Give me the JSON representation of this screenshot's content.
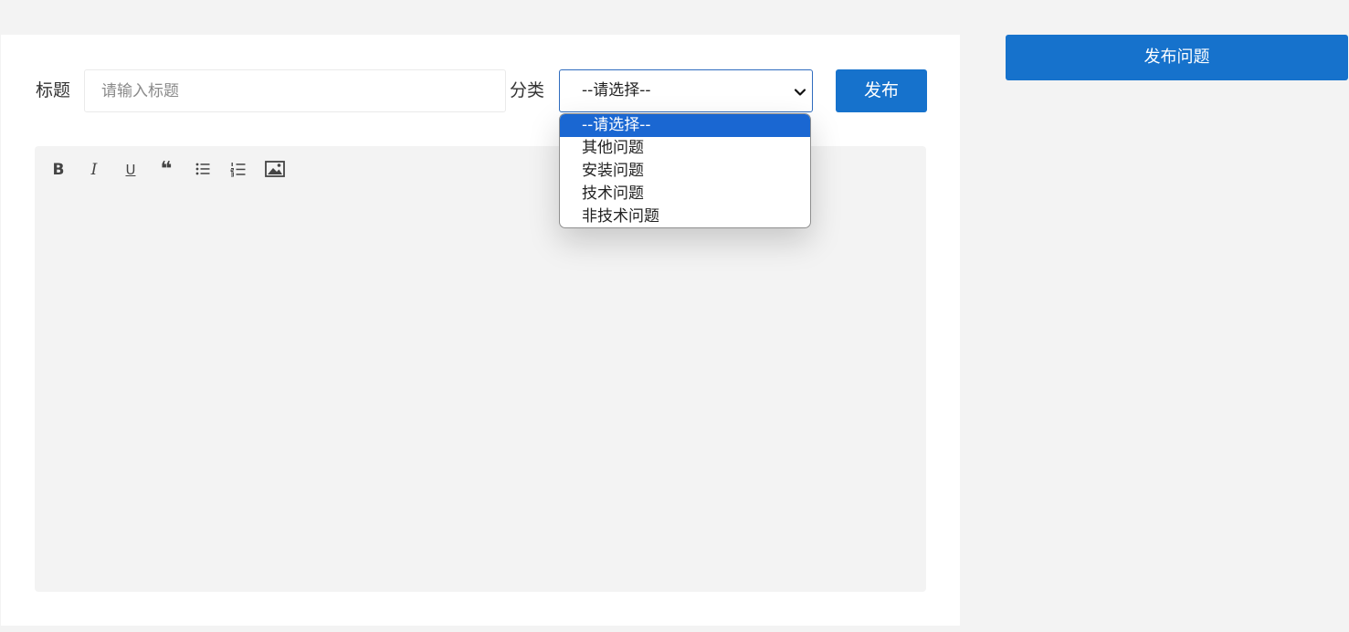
{
  "form": {
    "title_label": "标题",
    "title_placeholder": "请输入标题",
    "title_value": "",
    "category_label": "分类",
    "category_selected": "--请选择--",
    "publish_label": "发布"
  },
  "editor": {
    "toolbar": [
      {
        "name": "bold-icon",
        "glyph": "B"
      },
      {
        "name": "italic-icon",
        "glyph": "I"
      },
      {
        "name": "underline-icon",
        "glyph": "U"
      },
      {
        "name": "quote-icon",
        "glyph": "❝"
      },
      {
        "name": "bullet-list-icon",
        "glyph": ""
      },
      {
        "name": "numbered-list-icon",
        "glyph": ""
      },
      {
        "name": "image-icon",
        "glyph": ""
      }
    ]
  },
  "sidebar": {
    "ask_button_label": "发布问题"
  },
  "dropdown": {
    "options": [
      "--请选择--",
      "其他问题",
      "安装问题",
      "技术问题",
      "非技术问题"
    ],
    "highlighted_index": 0
  },
  "colors": {
    "accent": "#1672cc",
    "highlight": "#1a67d2",
    "page_bg": "#f3f3f3",
    "editor_bg": "#f3f3f3"
  }
}
